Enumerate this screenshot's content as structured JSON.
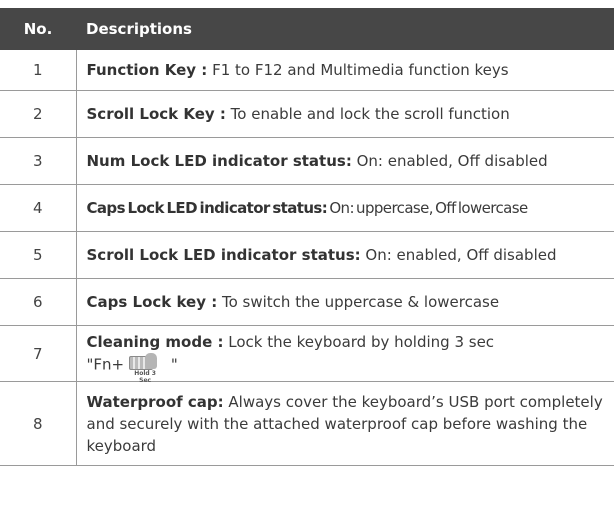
{
  "table": {
    "headers": {
      "no": "No.",
      "descriptions": "Descriptions"
    },
    "rows": [
      {
        "no": "1",
        "term": "Function Key :",
        "text": " F1 to F12 and Multimedia function keys"
      },
      {
        "no": "2",
        "term": "Scroll Lock Key :",
        "text": " To enable and lock the scroll function"
      },
      {
        "no": "3",
        "term": "Num Lock LED indicator status:",
        "text": " On: enabled, Off disabled"
      },
      {
        "no": "4",
        "term": "Caps Lock LED indicator status:",
        "text": " On: uppercase, Off lowercase"
      },
      {
        "no": "5",
        "term": "Scroll Lock LED indicator status:",
        "text": " On: enabled, Off disabled"
      },
      {
        "no": "6",
        "term": "Caps Lock key :",
        "text": " To switch the uppercase & lowercase"
      },
      {
        "no": "7",
        "term": "Cleaning mode :",
        "text": " Lock the keyboard by holding 3 sec",
        "line2_prefix": "\"Fn+",
        "line2_suffix": " \"",
        "icon": "keyboard-hand-icon",
        "icon_caption": "Hold 3 Sec"
      },
      {
        "no": "8",
        "term": "Waterproof cap:",
        "text": " Always cover the keyboard’s USB port completely and securely with the attached waterproof cap before washing the keyboard"
      }
    ]
  }
}
